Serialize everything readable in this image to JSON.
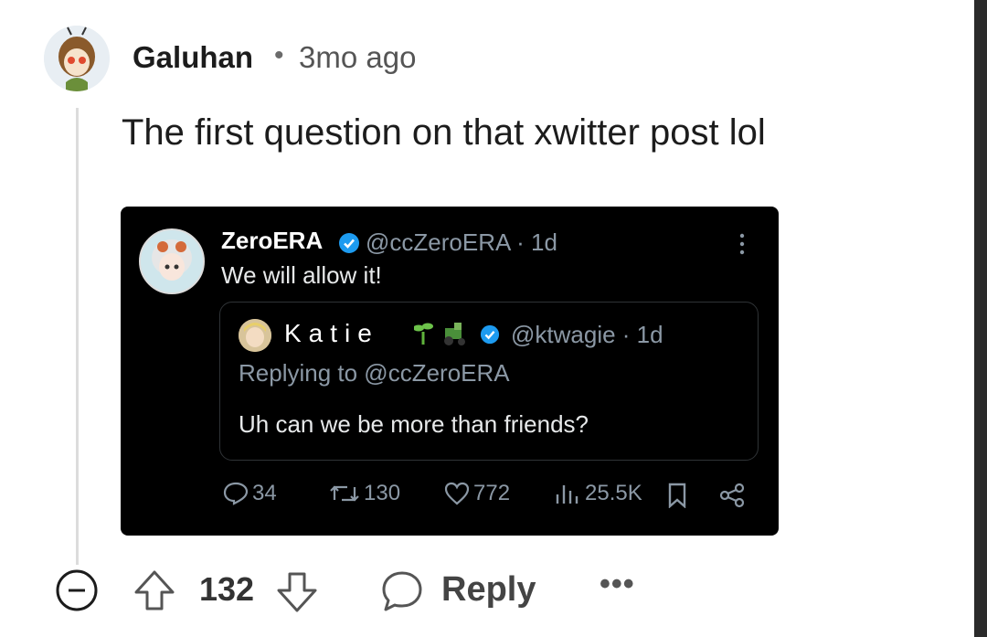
{
  "comment": {
    "username": "Galuhan",
    "separator": "•",
    "time": "3mo ago",
    "text": "The first question on that xwitter post lol"
  },
  "embed": {
    "post": {
      "name": "ZeroERA",
      "handle": "@ccZeroERA · 1d",
      "text": "We will allow it!"
    },
    "quote": {
      "name": "Katie",
      "handle": "@ktwagie · 1d",
      "replying": "Replying to @ccZeroERA",
      "text": "Uh can we be more than friends?"
    },
    "stats": {
      "replies": "34",
      "reposts": "130",
      "likes": "772",
      "views": "25.5K"
    },
    "colors": {
      "verified": "#1d9bf0",
      "background": "#000000",
      "muted": "#8b98a5"
    }
  },
  "actions": {
    "vote_count": "132",
    "reply_label": "Reply",
    "more_label": "•••"
  },
  "icons": [
    "collapse-icon",
    "upvote-icon",
    "downvote-icon",
    "comment-bubble-icon",
    "more-icon",
    "verified-icon",
    "kebab-icon",
    "bookmark-icon",
    "share-icon"
  ]
}
